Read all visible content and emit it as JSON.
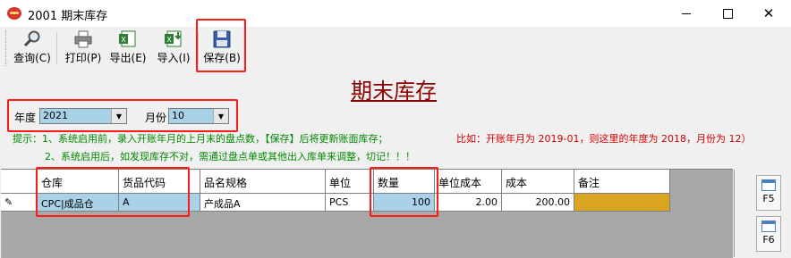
{
  "window": {
    "title": "2001 期末库存",
    "minimize": "—",
    "maximize": "☐",
    "close": "✕"
  },
  "toolbar": {
    "query": "查询(C)",
    "print": "打印(P)",
    "export": "导出(E)",
    "import": "导入(I)",
    "save": "保存(B)"
  },
  "page_title": "期末库存",
  "filters": {
    "year_label": "年度",
    "year_value": "2021",
    "month_label": "月份",
    "month_value": "10"
  },
  "hints": {
    "line1": "提示：1、系统启用前，录入开账年月的上月末的盘点数，【保存】后将更新账面库存；",
    "line2": "2、系统启用后，如发现库存不对，需通过盘点单或其他出入库单来调整，切记！！！",
    "example": "比如：开账年月为 2019-01，则这里的年度为 2018，月份为 12）"
  },
  "table": {
    "columns": [
      "仓库",
      "货品代码",
      "品名规格",
      "单位",
      "数量",
      "单位成本",
      "成本",
      "备注"
    ],
    "rows": [
      {
        "marker": "✎",
        "warehouse": "CPC|成品仓",
        "code": "A",
        "name": "产成品A",
        "unit": "PCS",
        "qty": "100",
        "unit_cost": "2.00",
        "cost": "200.00",
        "note": ""
      }
    ]
  },
  "side_buttons": {
    "f5": "F5",
    "f6": "F6"
  },
  "colors": {
    "title_red": "#8b0000",
    "hint_green": "#008800",
    "hint_red": "#d40000",
    "cell_blue": "#a9d1e8",
    "note_orange": "#daa520",
    "highlight": "#ff1a1a"
  }
}
